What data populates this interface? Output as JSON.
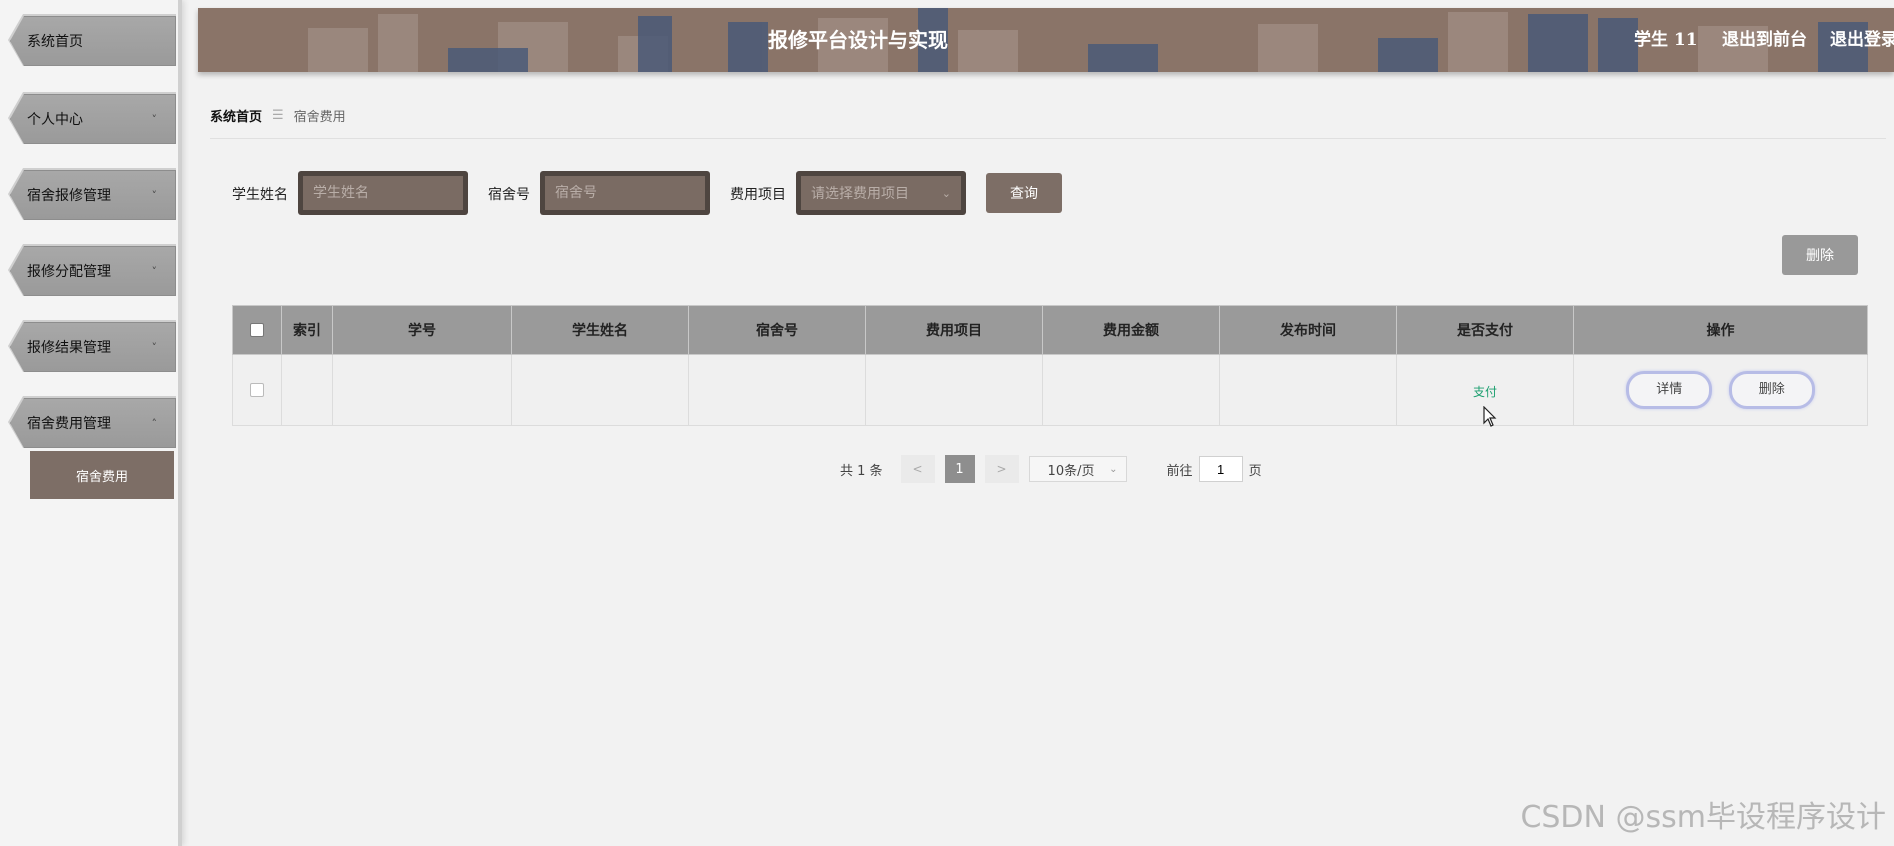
{
  "sidebar": {
    "items": [
      {
        "label": "系统首页",
        "chevron": ""
      },
      {
        "label": "个人中心",
        "chevron": "˅"
      },
      {
        "label": "宿舍报修管理",
        "chevron": "˅"
      },
      {
        "label": "报修分配管理",
        "chevron": "˅"
      },
      {
        "label": "报修结果管理",
        "chevron": "˅"
      },
      {
        "label": "宿舍费用管理",
        "chevron": "˄"
      }
    ],
    "submenu": {
      "label": "宿舍费用"
    }
  },
  "header": {
    "title": "报修平台设计与实现",
    "user": "学生 11",
    "to_front": "退出到前台",
    "logout": "退出登录"
  },
  "breadcrumb": {
    "home": "系统首页",
    "separator": "☰",
    "current": "宿舍费用"
  },
  "search": {
    "student_name_label": "学生姓名",
    "student_name_placeholder": "学生姓名",
    "dorm_label": "宿舍号",
    "dorm_placeholder": "宿舍号",
    "fee_item_label": "费用项目",
    "fee_item_placeholder": "请选择费用项目",
    "query_label": "查询"
  },
  "toolbar": {
    "delete_label": "删除"
  },
  "table": {
    "headers": [
      "索引",
      "学号",
      "学生姓名",
      "宿舍号",
      "费用项目",
      "费用金额",
      "发布时间",
      "是否支付",
      "操作"
    ],
    "rows": [
      {
        "index": "",
        "student_no": "",
        "student_name": "",
        "dorm_no": "",
        "fee_item": "",
        "fee_amount": "",
        "publish_time": "",
        "paid": "支付",
        "detail_label": "详情",
        "delete_label": "删除"
      }
    ]
  },
  "pagination": {
    "total": "共 1 条",
    "prev": "<",
    "current_page": "1",
    "next": ">",
    "page_size": "10条/页",
    "goto_label": "前往",
    "goto_value": "1",
    "page_suffix": "页"
  },
  "watermark": "CSDN @ssm毕设程序设计",
  "colors": {
    "accent": "#7d6e66",
    "header": "#8a7468",
    "paid_link": "#1a9e6e"
  }
}
